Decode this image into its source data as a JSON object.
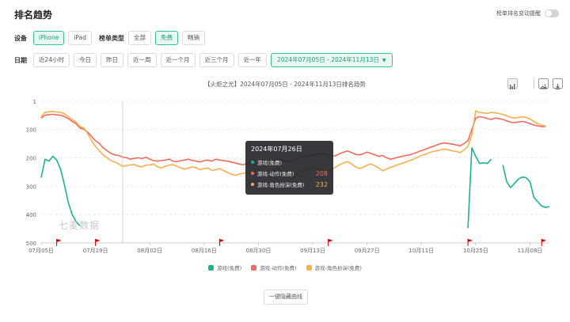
{
  "header": {
    "title": "排名趋势",
    "alert_label": "榜单排名变动提醒"
  },
  "filters": {
    "device_label": "设备",
    "devices": [
      "iPhone",
      "iPad"
    ],
    "device_active": "iPhone",
    "chart_type_label": "榜单类型",
    "chart_types": [
      "全部",
      "免费",
      "畅销"
    ],
    "chart_type_active": "免费",
    "date_label": "日期",
    "date_presets": [
      "近24小时",
      "今日",
      "昨日",
      "近一周",
      "近一个月",
      "近三个月",
      "近一年"
    ],
    "date_range": "2024年07月05日 - 2024年11月13日"
  },
  "chart_data": {
    "type": "line",
    "title": "【火炬之光】2024年07月05日 - 2024年11月13日排名趋势",
    "y_reversed": true,
    "ylim": [
      1,
      500
    ],
    "y_ticks": [
      "1",
      "100",
      "200",
      "300",
      "400",
      "500"
    ],
    "x_tick_labels": [
      "07月05日",
      "07月19日",
      "08月02日",
      "08月16日",
      "08月30日",
      "09月13日",
      "09月27日",
      "10月11日",
      "10月25日",
      "11月08日"
    ],
    "grid": true,
    "legend_position": "bottom",
    "series": [
      {
        "name": "游戏(免费)",
        "color": "#1db38e",
        "segments": [
          {
            "start_day": 0,
            "values": [
              270,
              205,
              212,
              195,
              208,
              240,
              295,
              358,
              400,
              425,
              440
            ]
          },
          {
            "start_day": 110,
            "values": [
              448,
              165,
              195,
              220,
              218,
              220,
              205
            ]
          },
          {
            "start_day": 119,
            "values": [
              225,
              285,
              305,
              290,
              275,
              268,
              270,
              285,
              340,
              355,
              370,
              375,
              372
            ]
          }
        ]
      },
      {
        "name": "游戏-动作(免费)",
        "color": "#ee6b5e",
        "start_day": 0,
        "values": [
          60,
          50,
          48,
          47,
          49,
          50,
          55,
          62,
          72,
          80,
          95,
          100,
          110,
          125,
          140,
          150,
          165,
          175,
          185,
          190,
          192,
          198,
          200,
          205,
          202,
          200,
          203,
          198,
          205,
          210,
          212,
          210,
          208,
          205,
          212,
          214,
          210,
          208,
          205,
          210,
          212,
          215,
          210,
          208,
          212,
          205,
          208,
          210,
          212,
          215,
          218,
          222,
          225,
          220,
          215,
          210,
          215,
          218,
          215,
          212,
          208,
          205,
          210,
          212,
          215,
          208,
          202,
          198,
          195,
          192,
          190,
          188,
          185,
          186,
          190,
          195,
          192,
          185,
          180,
          176,
          182,
          188,
          190,
          186,
          180,
          185,
          190,
          195,
          192,
          200,
          205,
          202,
          198,
          195,
          192,
          190,
          185,
          180,
          175,
          170,
          165,
          160,
          155,
          150,
          148,
          150,
          152,
          155,
          158,
          150,
          140,
          100,
          60,
          55,
          58,
          62,
          65,
          60,
          62,
          65,
          70,
          75,
          76,
          74,
          72,
          75,
          80,
          85,
          88,
          90,
          90
        ]
      },
      {
        "name": "游戏-角色扮演(免费)",
        "color": "#f5b04f",
        "start_day": 0,
        "values": [
          55,
          40,
          38,
          37,
          39,
          40,
          45,
          55,
          65,
          75,
          90,
          95,
          115,
          140,
          160,
          175,
          190,
          200,
          210,
          215,
          222,
          230,
          228,
          225,
          224,
          230,
          232,
          226,
          225,
          222,
          232,
          236,
          230,
          226,
          224,
          230,
          236,
          240,
          236,
          232,
          236,
          242,
          238,
          236,
          245,
          242,
          238,
          245,
          252,
          258,
          262,
          258,
          255,
          252,
          258,
          262,
          258,
          255,
          250,
          246,
          244,
          240,
          245,
          250,
          258,
          262,
          255,
          248,
          242,
          238,
          234,
          236,
          240,
          245,
          248,
          240,
          232,
          224,
          218,
          214,
          222,
          232,
          238,
          234,
          226,
          222,
          228,
          236,
          246,
          240,
          234,
          230,
          224,
          220,
          215,
          210,
          205,
          198,
          192,
          188,
          182,
          178,
          175,
          172,
          170,
          172,
          176,
          178,
          182,
          172,
          160,
          120,
          35,
          40,
          42,
          44,
          40,
          42,
          44,
          48,
          52,
          58,
          60,
          58,
          56,
          58,
          64,
          72,
          80,
          85,
          88
        ]
      }
    ],
    "tooltip": {
      "title": "2024年07月26日",
      "rows": [
        {
          "name": "游戏(免费)",
          "value": ""
        },
        {
          "name": "游戏-动作(免费)",
          "value": "208"
        },
        {
          "name": "游戏-角色扮演(免费)",
          "value": "232"
        }
      ]
    }
  },
  "watermark": "七麦数据",
  "hide_button_label": "一键隐藏曲线"
}
